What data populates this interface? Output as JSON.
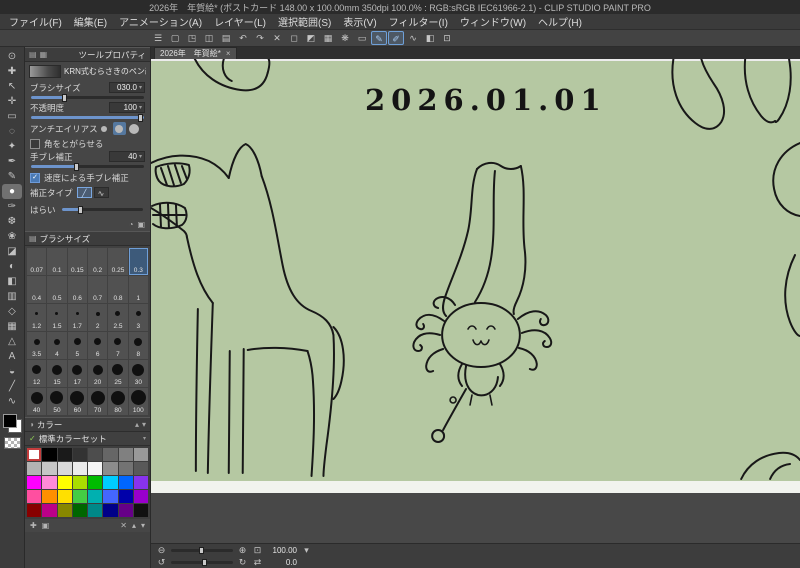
{
  "window": {
    "title": "2026年　年賀絵* (ポストカード 148.00 x 100.00mm 350dpi 100.0% : RGB:sRGB IEC61966-2.1) - CLIP STUDIO PAINT PRO"
  },
  "menu_bar": {
    "items": [
      {
        "label": "ファイル(F)"
      },
      {
        "label": "編集(E)"
      },
      {
        "label": "アニメーション(A)"
      },
      {
        "label": "レイヤー(L)"
      },
      {
        "label": "選択範囲(S)"
      },
      {
        "label": "表示(V)"
      },
      {
        "label": "フィルター(I)"
      },
      {
        "label": "ウィンドウ(W)"
      },
      {
        "label": "ヘルプ(H)"
      }
    ]
  },
  "toolbar": {
    "active_indices": [
      13,
      14
    ],
    "icons": [
      {
        "name": "main-menu-icon",
        "glyph": "☰"
      },
      {
        "name": "new-canvas-icon",
        "glyph": "▢"
      },
      {
        "name": "open-file-icon",
        "glyph": "◳"
      },
      {
        "name": "save-icon",
        "glyph": "◫"
      },
      {
        "name": "export-icon",
        "glyph": "▤"
      },
      {
        "name": "undo-icon",
        "glyph": "↶"
      },
      {
        "name": "redo-icon",
        "glyph": "↷"
      },
      {
        "name": "delete-icon",
        "glyph": "✕"
      },
      {
        "name": "clear-icon",
        "glyph": "◻"
      },
      {
        "name": "invert-selection-icon",
        "glyph": "◩"
      },
      {
        "name": "grid-icon",
        "glyph": "▦"
      },
      {
        "name": "light-icon",
        "glyph": "❋"
      },
      {
        "name": "selection-launcher-icon",
        "glyph": "▭"
      },
      {
        "name": "snap-ruler-icon",
        "glyph": "✎"
      },
      {
        "name": "snap-special-ruler-icon",
        "glyph": "✐"
      },
      {
        "name": "snap-curve-icon",
        "glyph": "∿"
      },
      {
        "name": "material-icon",
        "glyph": "◧"
      },
      {
        "name": "fit-view-icon",
        "glyph": "⊡"
      }
    ]
  },
  "tool_strip": {
    "selected_index": 9,
    "tools": [
      {
        "name": "zoom-tool-icon",
        "glyph": "⊙"
      },
      {
        "name": "move-canvas-tool-icon",
        "glyph": "✚"
      },
      {
        "name": "operation-tool-icon",
        "glyph": "↖"
      },
      {
        "name": "layer-move-tool-icon",
        "glyph": "✛"
      },
      {
        "name": "selection-tool-icon",
        "glyph": "▭"
      },
      {
        "name": "lasso-tool-icon",
        "glyph": "◌"
      },
      {
        "name": "eyedropper-tool-icon",
        "glyph": "✦"
      },
      {
        "name": "pen-tool-icon",
        "glyph": "✒"
      },
      {
        "name": "pencil-tool-icon",
        "glyph": "✎"
      },
      {
        "name": "marker-tool-icon",
        "glyph": "●"
      },
      {
        "name": "brush-tool-icon",
        "glyph": "✑"
      },
      {
        "name": "airbrush-tool-icon",
        "glyph": "❆"
      },
      {
        "name": "decoration-tool-icon",
        "glyph": "❀"
      },
      {
        "name": "eraser-tool-icon",
        "glyph": "◪"
      },
      {
        "name": "blend-tool-icon",
        "glyph": "◐"
      },
      {
        "name": "fill-tool-icon",
        "glyph": "◧"
      },
      {
        "name": "gradient-tool-icon",
        "glyph": "▥"
      },
      {
        "name": "figure-tool-icon",
        "glyph": "◇"
      },
      {
        "name": "frame-border-tool-icon",
        "glyph": "▦"
      },
      {
        "name": "ruler-tool-icon",
        "glyph": "△"
      },
      {
        "name": "text-tool-icon",
        "glyph": "A"
      },
      {
        "name": "balloon-tool-icon",
        "glyph": "◒"
      },
      {
        "name": "line-tool-icon",
        "glyph": "╱"
      },
      {
        "name": "line-correction-tool-icon",
        "glyph": "∿"
      }
    ]
  },
  "tool_property": {
    "panel_title": "ツールプロパティ",
    "tool_name": "KRN式むらさきのペン改",
    "brush_size": {
      "label": "ブラシサイズ",
      "value": "030.0"
    },
    "opacity": {
      "label": "不透明度",
      "value": "100"
    },
    "antialias": {
      "label": "アンチエイリアス"
    },
    "antialias_selected_index": 1,
    "antialias_options": [
      {
        "name": "antialias-none"
      },
      {
        "name": "antialias-weak"
      },
      {
        "name": "antialias-medium"
      },
      {
        "name": "antialias-strong"
      }
    ],
    "sharp_corner": {
      "label": "角をとがらせる",
      "checked": false
    },
    "stabilization": {
      "label": "手ブレ補正",
      "value": "40"
    },
    "speed_stabilization": {
      "label": "速度による手ブレ補正",
      "checked": true
    },
    "correction_type": {
      "label": "補正タイプ"
    },
    "correction_selected_index": 0,
    "correction_options": [
      {
        "name": "correction-type-stroke",
        "glyph": "╱"
      },
      {
        "name": "correction-type-curve",
        "glyph": "∿"
      }
    ],
    "harai": {
      "label": "はらい"
    }
  },
  "brush_size_panel": {
    "title": "ブラシサイズ",
    "selected_size": "0.3",
    "sizes": [
      "0.07",
      "0.1",
      "0.15",
      "0.2",
      "0.25",
      "0.3",
      "0.4",
      "0.5",
      "0.6",
      "0.7",
      "0.8",
      "1",
      "1.2",
      "1.5",
      "1.7",
      "2",
      "2.5",
      "3",
      "3.5",
      "4",
      "5",
      "6",
      "7",
      "8",
      "12",
      "15",
      "17",
      "20",
      "25",
      "30",
      "40",
      "50",
      "60",
      "70",
      "80",
      "100"
    ]
  },
  "color_panel": {
    "tab_label": "カラー",
    "set_label": "標準カラーセット",
    "selected_index": 0,
    "swatches": [
      "#ffffff",
      "#000000",
      "#1a1a1a",
      "#333333",
      "#4d4d4d",
      "#666666",
      "#808080",
      "#999999",
      "#b3b3b3",
      "#c6c6c6",
      "#d9d9d9",
      "#ebebeb",
      "#f5f5f5",
      "#8c8c8c",
      "#737373",
      "#595959",
      "#ff00ff",
      "#ff8ad8",
      "#ffff00",
      "#aadd00",
      "#00bb00",
      "#00ccff",
      "#0066ff",
      "#8833ee",
      "#ff4fa0",
      "#ff9000",
      "#ffe000",
      "#44cc44",
      "#00b0b0",
      "#4466ff",
      "#0000aa",
      "#9900cc",
      "#880000",
      "#bb0088",
      "#888800",
      "#006600",
      "#008888",
      "#000088",
      "#660088",
      "#111111"
    ]
  },
  "canvas_tab": {
    "label": "2026年　年賀絵*"
  },
  "canvas": {
    "date_text": "2026.01.01"
  },
  "status_bar": {
    "zoom_value": "100.00",
    "rotation_value": "0.0"
  },
  "icons": {
    "panel_menu": "▤",
    "caret_down": "▾",
    "caret_up": "▴",
    "dropdown_arrow": "▼",
    "close": "×",
    "check": "✓",
    "zoom_out": "⊖",
    "zoom_in": "⊕",
    "fit_screen": "⊡",
    "rotate_ccw": "↺",
    "rotate_cw": "↻",
    "swap": "⇄",
    "grid": "▦",
    "palette": "◑",
    "trash": "✕",
    "add": "✚",
    "history": "◔",
    "register": "▣"
  }
}
